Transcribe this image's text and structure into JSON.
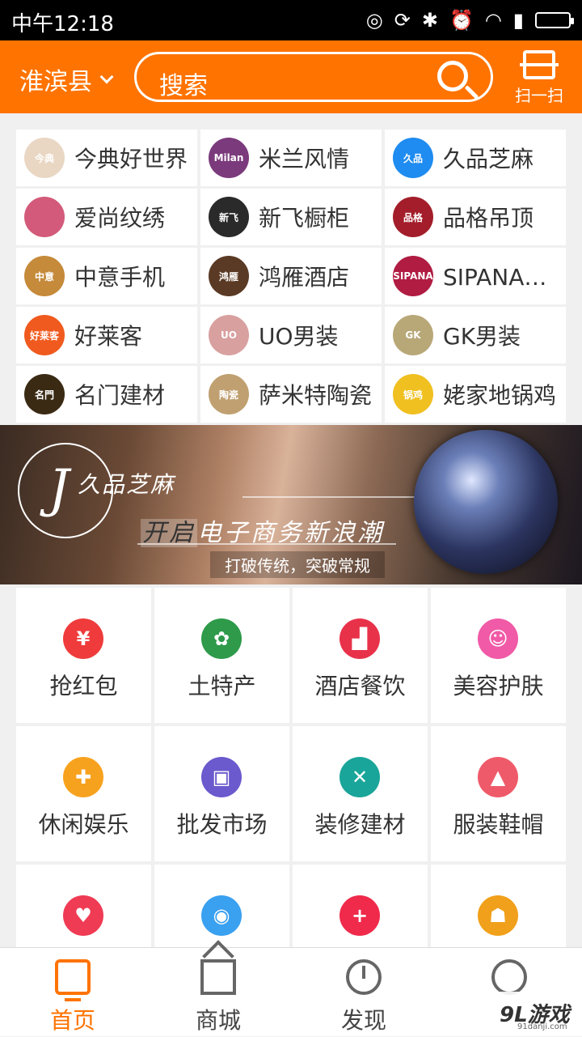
{
  "status": {
    "time": "中午12:18"
  },
  "topbar": {
    "location": "淮滨县",
    "search_placeholder": "搜索",
    "scan_label": "扫一扫"
  },
  "brands": [
    {
      "name": "今典好世界",
      "logo_color": "#e9d7c3",
      "logo_text": "今典"
    },
    {
      "name": "米兰风情",
      "logo_color": "#7b3a7c",
      "logo_text": "Milan"
    },
    {
      "name": "久品芝麻",
      "logo_color": "#1e8cf0",
      "logo_text": "久品"
    },
    {
      "name": "爱尚纹绣",
      "logo_color": "#d35a7a",
      "logo_text": ""
    },
    {
      "name": "新飞橱柜",
      "logo_color": "#2a2a2a",
      "logo_text": "新飞"
    },
    {
      "name": "品格吊顶",
      "logo_color": "#a31d2a",
      "logo_text": "品格"
    },
    {
      "name": "中意手机",
      "logo_color": "#c58a3a",
      "logo_text": "中意"
    },
    {
      "name": "鸿雁酒店",
      "logo_color": "#5a3a24",
      "logo_text": "鸿雁"
    },
    {
      "name": "SIPANA酒…",
      "logo_color": "#b01c42",
      "logo_text": "SIPANA"
    },
    {
      "name": "好莱客",
      "logo_color": "#f05a1e",
      "logo_text": "好莱客"
    },
    {
      "name": "UO男装",
      "logo_color": "#d9a0a0",
      "logo_text": "UO"
    },
    {
      "name": "GK男装",
      "logo_color": "#b8a878",
      "logo_text": "GK"
    },
    {
      "name": "名门建材",
      "logo_color": "#3a2a14",
      "logo_text": "名門"
    },
    {
      "name": "萨米特陶瓷",
      "logo_color": "#c0a070",
      "logo_text": "陶瓷"
    },
    {
      "name": "姥家地锅鸡",
      "logo_color": "#f0c020",
      "logo_text": "锅鸡"
    }
  ],
  "banner": {
    "brand_name": "久品芝麻",
    "headline_hl": "开启",
    "headline_rest": "电子商务新浪潮",
    "subline": "打破传统，突破常规"
  },
  "categories": [
    {
      "label": "抢红包",
      "icon": "red-envelope-icon",
      "color": "#ef3b3b",
      "glyph": "¥"
    },
    {
      "label": "土特产",
      "icon": "carrot-icon",
      "color": "#2e9a4a",
      "glyph": "✿"
    },
    {
      "label": "酒店餐饮",
      "icon": "factory-icon",
      "color": "#e8324a",
      "glyph": "▟"
    },
    {
      "label": "美容护肤",
      "icon": "woman-icon",
      "color": "#f05aa6",
      "glyph": "☺"
    },
    {
      "label": "休闲娱乐",
      "icon": "gamepad-icon",
      "color": "#f7a21f",
      "glyph": "✚"
    },
    {
      "label": "批发市场",
      "icon": "shopping-bag-icon",
      "color": "#6a5acd",
      "glyph": "▣"
    },
    {
      "label": "装修建材",
      "icon": "tools-icon",
      "color": "#1aa59a",
      "glyph": "✕"
    },
    {
      "label": "服装鞋帽",
      "icon": "jacket-icon",
      "color": "#ef5a6a",
      "glyph": "▲"
    },
    {
      "label": "",
      "icon": "heart-icon",
      "color": "#ef3b54",
      "glyph": "♥"
    },
    {
      "label": "",
      "icon": "car-icon",
      "color": "#3aa0f0",
      "glyph": "◉"
    },
    {
      "label": "",
      "icon": "medical-kit-icon",
      "color": "#ef2a4a",
      "glyph": "+"
    },
    {
      "label": "",
      "icon": "graduate-icon",
      "color": "#f0a01a",
      "glyph": "☗"
    }
  ],
  "tabs": [
    {
      "label": "首页",
      "icon": "home-icon"
    },
    {
      "label": "商城",
      "icon": "shop-icon"
    },
    {
      "label": "发现",
      "icon": "discover-icon"
    },
    {
      "label": "",
      "icon": "user-icon"
    }
  ],
  "watermark": {
    "text": "9L游戏",
    "sub": "91danji.com"
  }
}
